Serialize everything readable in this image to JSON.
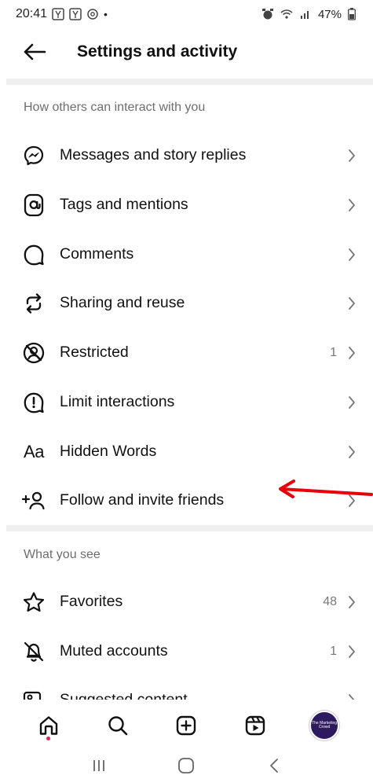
{
  "status_bar": {
    "time": "20:41",
    "battery": "47%"
  },
  "header": {
    "title": "Settings and activity"
  },
  "sections": [
    {
      "title": "How others can interact with you",
      "items": [
        {
          "label": "Messages and story replies",
          "count": "",
          "icon": "messenger-icon"
        },
        {
          "label": "Tags and mentions",
          "count": "",
          "icon": "at-sign-icon"
        },
        {
          "label": "Comments",
          "count": "",
          "icon": "comment-bubble-icon"
        },
        {
          "label": "Sharing and reuse",
          "count": "",
          "icon": "share-reuse-icon"
        },
        {
          "label": "Restricted",
          "count": "1",
          "icon": "restricted-icon"
        },
        {
          "label": "Limit interactions",
          "count": "",
          "icon": "limit-interactions-icon"
        },
        {
          "label": "Hidden Words",
          "count": "",
          "icon": "hidden-words-icon"
        },
        {
          "label": "Follow and invite friends",
          "count": "",
          "icon": "add-person-icon"
        }
      ]
    },
    {
      "title": "What you see",
      "items": [
        {
          "label": "Favorites",
          "count": "48",
          "icon": "star-icon"
        },
        {
          "label": "Muted accounts",
          "count": "1",
          "icon": "muted-bell-icon"
        },
        {
          "label": "Suggested content",
          "count": "",
          "icon": "suggested-content-icon"
        }
      ]
    }
  ],
  "bottom_nav": [
    "home-icon",
    "search-icon",
    "create-plus-icon",
    "reels-icon",
    "profile-avatar"
  ],
  "avatar_text": "The Marketing Crowd",
  "colors": {
    "annotation_arrow": "#e8000b",
    "home_dot": "#e0245e",
    "divider": "#f0f0f0"
  }
}
